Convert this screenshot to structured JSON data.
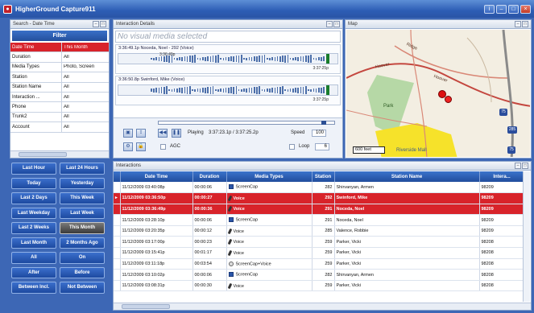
{
  "app": {
    "title": "HigherGround Capture911"
  },
  "search": {
    "header": "Search - Date Time",
    "filter_label": "Filter",
    "rows": [
      {
        "key": "Date Time",
        "value": "This Month",
        "selected": true
      },
      {
        "key": "Duration",
        "value": "All"
      },
      {
        "key": "Media Types",
        "value": "Photo, Screen"
      },
      {
        "key": "Station",
        "value": "All"
      },
      {
        "key": "Station Name",
        "value": "All"
      },
      {
        "key": "Interaction ...",
        "value": "All"
      },
      {
        "key": "Phone",
        "value": "All"
      },
      {
        "key": "Trunk2",
        "value": "All"
      },
      {
        "key": "Account",
        "value": "All"
      }
    ],
    "quick_buttons": [
      "Last Hour",
      "Last 24 Hours",
      "Today",
      "Yesterday",
      "Last 2 Days",
      "This Week",
      "Last Weekday",
      "Last Week",
      "Last 2 Weeks",
      "This Month",
      "Last Month",
      "2 Months Ago",
      "All",
      "On",
      "After",
      "Before",
      "Between Incl.",
      "Not Between"
    ],
    "active_button": "This Month"
  },
  "details": {
    "header": "Interaction Details",
    "no_media": "No visual media selected",
    "tracks": [
      {
        "label": "3:36:49.1p Noceda, Noel - 292 (Voice)",
        "start": "3:36:49p",
        "end": "3:37:25p"
      },
      {
        "label": "3:36:50.8p Swinford, Mike (Voice)",
        "start": "",
        "end": "3:37:25p"
      }
    ],
    "playing_label": "Playing",
    "playing_time": "3:37:23.1p / 3:37:25.2p",
    "speed_label": "Speed",
    "speed_value": "100",
    "agc_label": "AGC",
    "loop_label": "Loop",
    "loop_value": "6"
  },
  "map": {
    "header": "Map",
    "park_label": "Park",
    "scale_label": "600 feet",
    "mall_label": "Riverside Mall",
    "roads": [
      "Hoover",
      "Hoover",
      "Ridge"
    ],
    "road_markers": [
      "75",
      "285",
      "75"
    ]
  },
  "interactions": {
    "header": "Interactions",
    "columns": [
      "Date Time",
      "Duration",
      "Media Types",
      "Station",
      "Station Name",
      "Intera..."
    ],
    "rows": [
      {
        "datetime": "11/12/2009 03:40:08p",
        "duration": "00:00:06",
        "media": "ScreenCap",
        "media_icon": "screen",
        "station": "282",
        "name": "Shirvanyan, Armen",
        "id": "98209"
      },
      {
        "datetime": "11/12/2009 03:36:50p",
        "duration": "00:00:27",
        "media": "Voice",
        "media_icon": "voice",
        "station": "292",
        "name": "Swinford, Mike",
        "id": "98209",
        "selected": true
      },
      {
        "datetime": "11/12/2009 03:36:49p",
        "duration": "00:00:36",
        "media": "Voice",
        "media_icon": "voice",
        "station": "291",
        "name": "Noceda, Noel",
        "id": "98209",
        "selected": true
      },
      {
        "datetime": "11/12/2009 03:28:10p",
        "duration": "00:00:06",
        "media": "ScreenCap",
        "media_icon": "screen",
        "station": "291",
        "name": "Noceda, Noel",
        "id": "98209"
      },
      {
        "datetime": "11/12/2009 03:20:35p",
        "duration": "00:00:12",
        "media": "Voice",
        "media_icon": "voice",
        "station": "285",
        "name": "Valence, Robbie",
        "id": "98209"
      },
      {
        "datetime": "11/12/2009 03:17:00p",
        "duration": "00:00:23",
        "media": "Voice",
        "media_icon": "voice",
        "station": "259",
        "name": "Parker, Vicki",
        "id": "98208"
      },
      {
        "datetime": "11/12/2009 03:15:41p",
        "duration": "00:01:17",
        "media": "Voice",
        "media_icon": "voice",
        "station": "259",
        "name": "Parker, Vicki",
        "id": "98208"
      },
      {
        "datetime": "11/12/2009 03:11:18p",
        "duration": "00:03:54",
        "media": "ScreenCap+Voice",
        "media_icon": "combo",
        "station": "259",
        "name": "Parker, Vicki",
        "id": "98208"
      },
      {
        "datetime": "11/12/2009 03:10:02p",
        "duration": "00:00:06",
        "media": "ScreenCap",
        "media_icon": "screen",
        "station": "282",
        "name": "Shirvanyan, Armen",
        "id": "98208"
      },
      {
        "datetime": "11/12/2009 03:08:31p",
        "duration": "00:00:30",
        "media": "Voice",
        "media_icon": "voice",
        "station": "259",
        "name": "Parker, Vicki",
        "id": "98208"
      }
    ]
  }
}
